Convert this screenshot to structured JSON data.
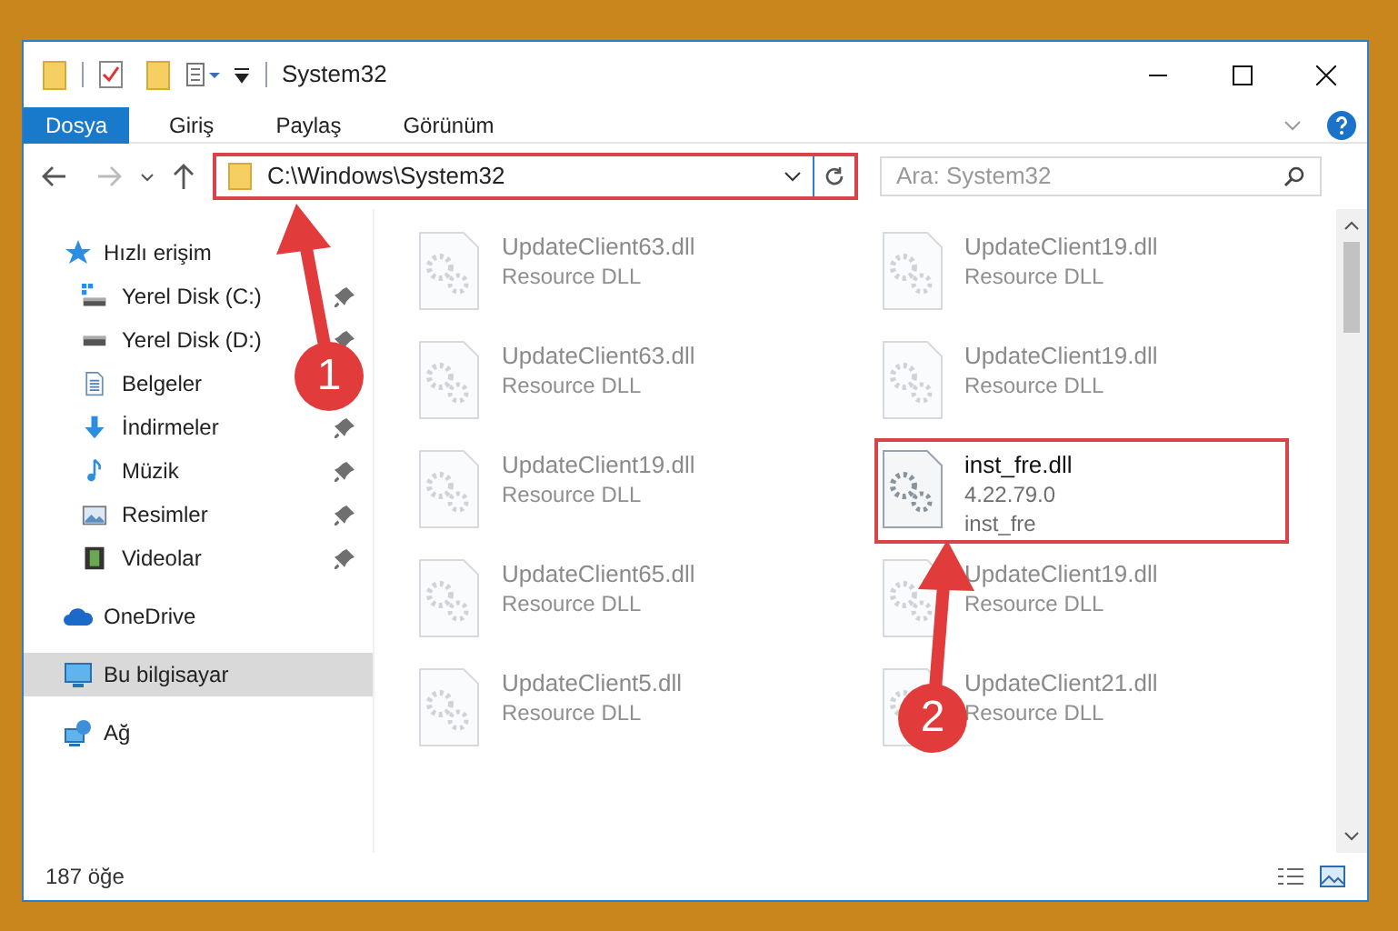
{
  "window": {
    "title": "System32"
  },
  "ribbon_tabs": [
    {
      "label": "Dosya",
      "selected": true
    },
    {
      "label": "Giriş",
      "selected": false
    },
    {
      "label": "Paylaş",
      "selected": false
    },
    {
      "label": "Görünüm",
      "selected": false
    }
  ],
  "address": {
    "path": "C:\\Windows\\System32",
    "highlighted": true
  },
  "search": {
    "placeholder": "Ara: System32"
  },
  "sidebar": [
    {
      "label": "Hızlı erişim",
      "kind": "quick",
      "selected": false,
      "children": [
        {
          "label": "Yerel Disk (C:)",
          "kind": "drive-c",
          "pinned": true
        },
        {
          "label": "Yerel Disk (D:)",
          "kind": "drive",
          "pinned": true
        },
        {
          "label": "Belgeler",
          "kind": "documents",
          "pinned": false
        },
        {
          "label": "İndirmeler",
          "kind": "downloads",
          "pinned": true
        },
        {
          "label": "Müzik",
          "kind": "music",
          "pinned": true
        },
        {
          "label": "Resimler",
          "kind": "pictures",
          "pinned": true
        },
        {
          "label": "Videolar",
          "kind": "videos",
          "pinned": true
        }
      ]
    },
    {
      "label": "OneDrive",
      "kind": "cloud",
      "selected": false
    },
    {
      "label": "Bu bilgisayar",
      "kind": "computer",
      "selected": true
    },
    {
      "label": "Ağ",
      "kind": "network",
      "selected": false
    }
  ],
  "files": [
    {
      "name": "UpdateClient63.dll",
      "lines": [
        "Resource DLL"
      ],
      "blurred": true,
      "highlighted": false
    },
    {
      "name": "UpdateClient19.dll",
      "lines": [
        "Resource DLL"
      ],
      "blurred": true,
      "highlighted": false
    },
    {
      "name": "UpdateClient63.dll",
      "lines": [
        "Resource DLL"
      ],
      "blurred": true,
      "highlighted": false
    },
    {
      "name": "UpdateClient19.dll",
      "lines": [
        "Resource DLL"
      ],
      "blurred": true,
      "highlighted": false
    },
    {
      "name": "UpdateClient19.dll",
      "lines": [
        "Resource DLL"
      ],
      "blurred": true,
      "highlighted": false
    },
    {
      "name": "inst_fre.dll",
      "lines": [
        "4.22.79.0",
        "inst_fre"
      ],
      "blurred": false,
      "highlighted": true
    },
    {
      "name": "UpdateClient65.dll",
      "lines": [
        "Resource DLL"
      ],
      "blurred": true,
      "highlighted": false
    },
    {
      "name": "UpdateClient19.dll",
      "lines": [
        "Resource DLL"
      ],
      "blurred": true,
      "highlighted": false
    },
    {
      "name": "UpdateClient5.dll",
      "lines": [
        "Resource DLL"
      ],
      "blurred": true,
      "highlighted": false
    },
    {
      "name": "UpdateClient21.dll",
      "lines": [
        "Resource DLL"
      ],
      "blurred": true,
      "highlighted": false
    }
  ],
  "status_bar": {
    "count": "187 öğe"
  },
  "callouts": [
    {
      "number": "1"
    },
    {
      "number": "2"
    }
  ]
}
